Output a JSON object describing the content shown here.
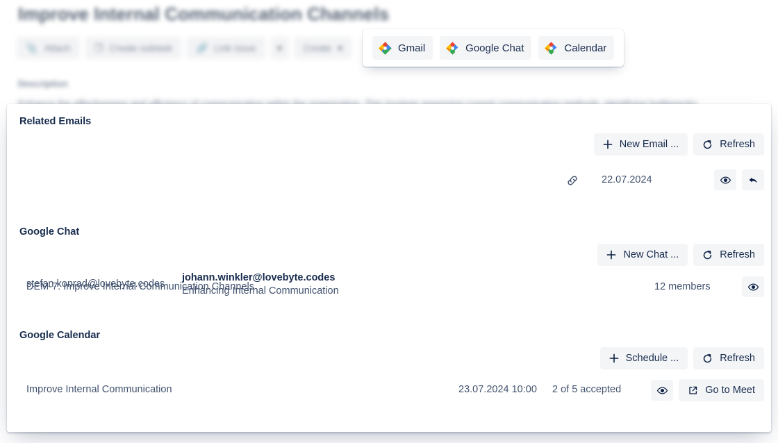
{
  "background": {
    "issue_title": "Improve Internal Communication Channels",
    "toolbar": [
      {
        "label": "Attach",
        "icon": "paperclip-icon"
      },
      {
        "label": "Create subtask",
        "icon": "subtask-icon"
      },
      {
        "label": "Link issue",
        "icon": "link-icon"
      },
      {
        "label": "",
        "icon": "chevron-down-icon"
      },
      {
        "label": "Create",
        "icon": "chevron-down-icon"
      }
    ],
    "description_label": "Description",
    "description_text": "Enhance the effectiveness and efficiency of communication within the organization. This involves assessing current communication methods, identifying bottlenecks,"
  },
  "app_picker": {
    "items": [
      {
        "label": "Gmail",
        "icon": "google-workspace-icon"
      },
      {
        "label": "Google Chat",
        "icon": "google-workspace-icon"
      },
      {
        "label": "Calendar",
        "icon": "google-workspace-icon"
      }
    ]
  },
  "dialog": {
    "emails": {
      "title": "Related Emails",
      "new_button": "New Email ...",
      "refresh_button": "Refresh",
      "row": {
        "from": "stefan.konrad@lovebyte.codes",
        "to": "johann.winkler@lovebyte.codes",
        "subject": "Enhancing Internal Communication",
        "date": "22.07.2024",
        "link_icon": "chain-link-icon",
        "view_icon": "eye-icon",
        "reply_icon": "reply-arrow-icon"
      }
    },
    "chat": {
      "title": "Google Chat",
      "new_button": "New Chat ...",
      "refresh_button": "Refresh",
      "row": {
        "name": "DEM-7: Improve Internal Communication Channels",
        "members": "12 members",
        "view_icon": "eye-icon"
      }
    },
    "calendar": {
      "title": "Google Calendar",
      "new_button": "Schedule ...",
      "refresh_button": "Refresh",
      "row": {
        "name": "Improve Internal Communication",
        "datetime": "23.07.2024 10:00",
        "attendance": "2 of 5 accepted",
        "view_icon": "eye-icon",
        "meet_button": "Go to Meet",
        "meet_icon": "external-link-icon"
      }
    }
  },
  "colors": {
    "text_primary": "#172b4d",
    "text_secondary": "#42526e",
    "button_bg": "#f4f5f7",
    "google_blue": "#4285f4",
    "google_red": "#ea4335",
    "google_yellow": "#fbbc04",
    "google_green": "#34a853"
  }
}
